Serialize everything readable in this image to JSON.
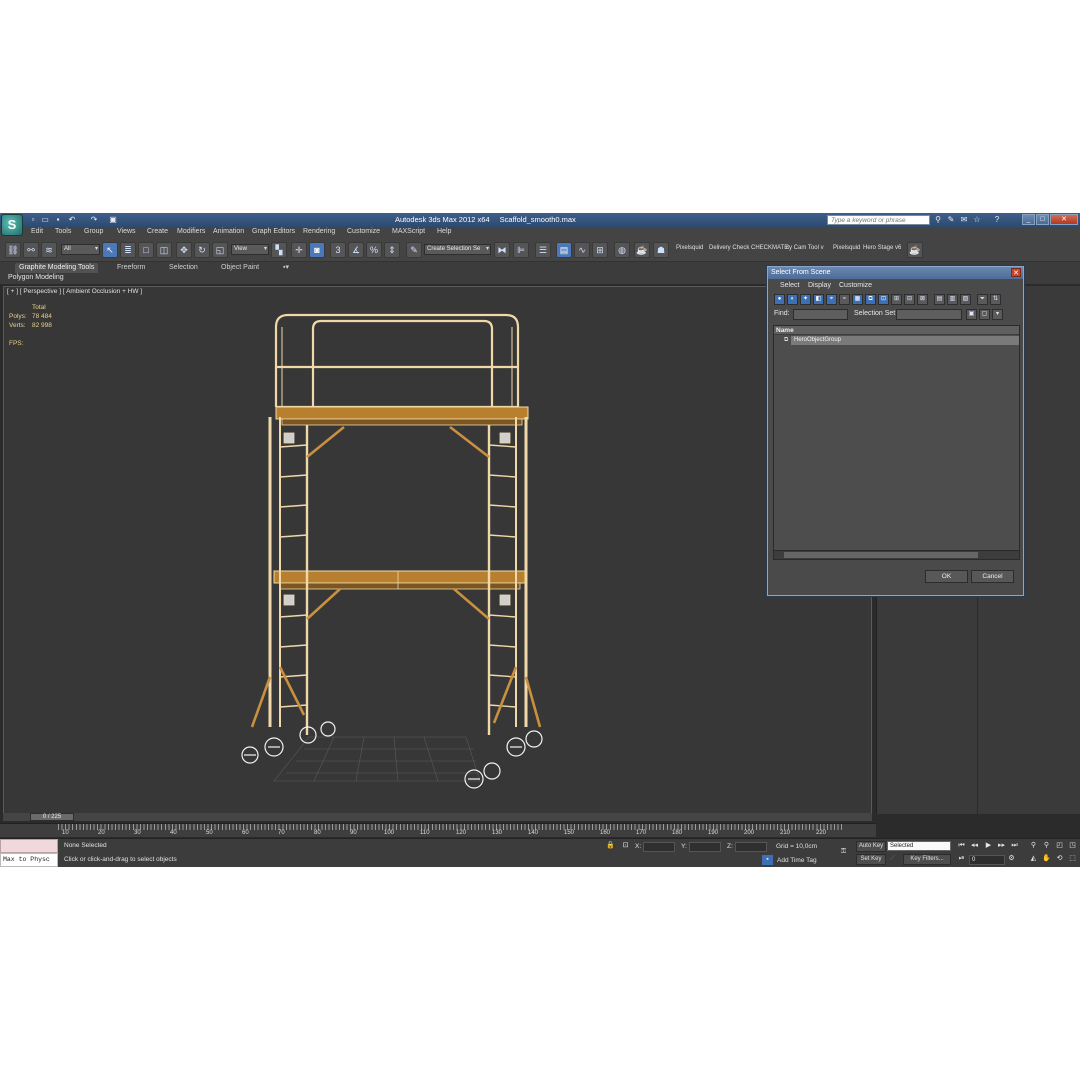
{
  "app": {
    "logo": "S",
    "title": "Autodesk 3ds Max  2012 x64",
    "file": "Scaffold_smooth0.max",
    "search_placeholder": "Type a keyword or phrase"
  },
  "menu": [
    "Edit",
    "Tools",
    "Group",
    "Views",
    "Create",
    "Modifiers",
    "Animation",
    "Graph Editors",
    "Rendering",
    "Customize",
    "MAXScript",
    "Help"
  ],
  "toolbar": {
    "filter_value": "All",
    "coord_value": "View",
    "snap_label": "3",
    "selection_set": "Create Selection Se",
    "plugin_buttons": [
      "Pixelsquid",
      "Delivery Check",
      "CHECKMATE",
      "ity Cam Tool v",
      "Pixelsquid",
      "Hero Stage v6"
    ]
  },
  "ribbon": {
    "tabs": [
      "Graphite Modeling Tools",
      "Freeform",
      "Selection",
      "Object Paint"
    ],
    "sub_label": "Polygon Modeling"
  },
  "viewport": {
    "label": "[ + ] [ Perspective ] [ Ambient Occlusion + HW ]",
    "stats": {
      "total_label": "Total",
      "polys_label": "Polys:",
      "polys_value": "78 484",
      "verts_label": "Verts:",
      "verts_value": "82 998",
      "fps_label": "FPS:"
    }
  },
  "dialog": {
    "title": "Select From Scene",
    "menu": [
      "Select",
      "Display",
      "Customize"
    ],
    "find_label": "Find:",
    "selset_label": "Selection Set:",
    "column_header": "Name",
    "items": [
      "HeroObjectGroup"
    ],
    "ok_label": "OK",
    "cancel_label": "Cancel"
  },
  "timeline": {
    "slider_label": "0 / 225",
    "ticks": [
      "0",
      "10",
      "20",
      "30",
      "40",
      "50",
      "60",
      "70",
      "80",
      "90",
      "100",
      "110",
      "120",
      "130",
      "140",
      "150",
      "160",
      "170",
      "180",
      "190",
      "200",
      "210",
      "220"
    ]
  },
  "status": {
    "maxscript_text": "Max to Physc",
    "selection_text": "None Selected",
    "prompt_text": "Click or click-and-drag to select objects",
    "x_label": "X:",
    "y_label": "Y:",
    "z_label": "Z:",
    "grid_text": "Grid = 10,0cm",
    "add_time_tag": "Add Time Tag",
    "auto_key": "Auto Key",
    "set_key": "Set Key",
    "key_mode_value": "Selected",
    "key_filters": "Key Filters...",
    "frame_value": "0"
  },
  "colors": {
    "viewport_bg": "#373737",
    "scaffold_wire": "#f0d8a8",
    "scaffold_wood": "#b8802e",
    "selection_blue": "#4a78b8",
    "stat_text": "#e8d38a"
  }
}
